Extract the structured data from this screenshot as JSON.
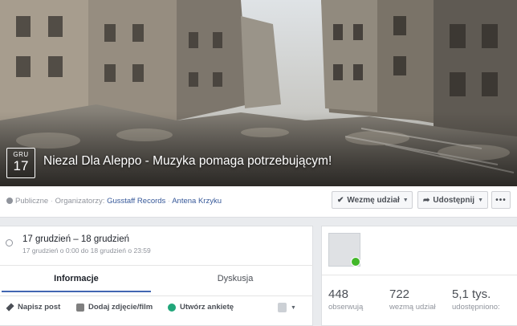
{
  "event": {
    "month": "GRU",
    "day": "17",
    "title": "Niezal Dla Aleppo - Muzyka pomaga potrzebującym!"
  },
  "meta": {
    "privacy": "Publiczne",
    "organizers_label": "Organizatorzy:",
    "organizer1": "Gusstaff Records",
    "organizer2": "Antena Krzyku"
  },
  "actions": {
    "going_label": "Wezmę udział",
    "share_label": "Udostępnij",
    "more_label": "•••"
  },
  "datetime": {
    "range": "17 grudzień – 18 grudzień",
    "detail": "17 grudzień o 0:00 do 18 grudzień o 23:59"
  },
  "tabs": {
    "info": "Informacje",
    "discussion": "Dyskusja"
  },
  "composer": {
    "post": "Napisz post",
    "photo": "Dodaj zdjęcie/film",
    "poll": "Utwórz ankietę"
  },
  "stats": [
    {
      "value": "448",
      "label": "obserwują"
    },
    {
      "value": "722",
      "label": "wezmą udział"
    },
    {
      "value": "5,1 tys.",
      "label": "udostępniono:"
    }
  ],
  "colors": {
    "link": "#365899",
    "accent": "#4267b2",
    "online": "#42b72a"
  }
}
